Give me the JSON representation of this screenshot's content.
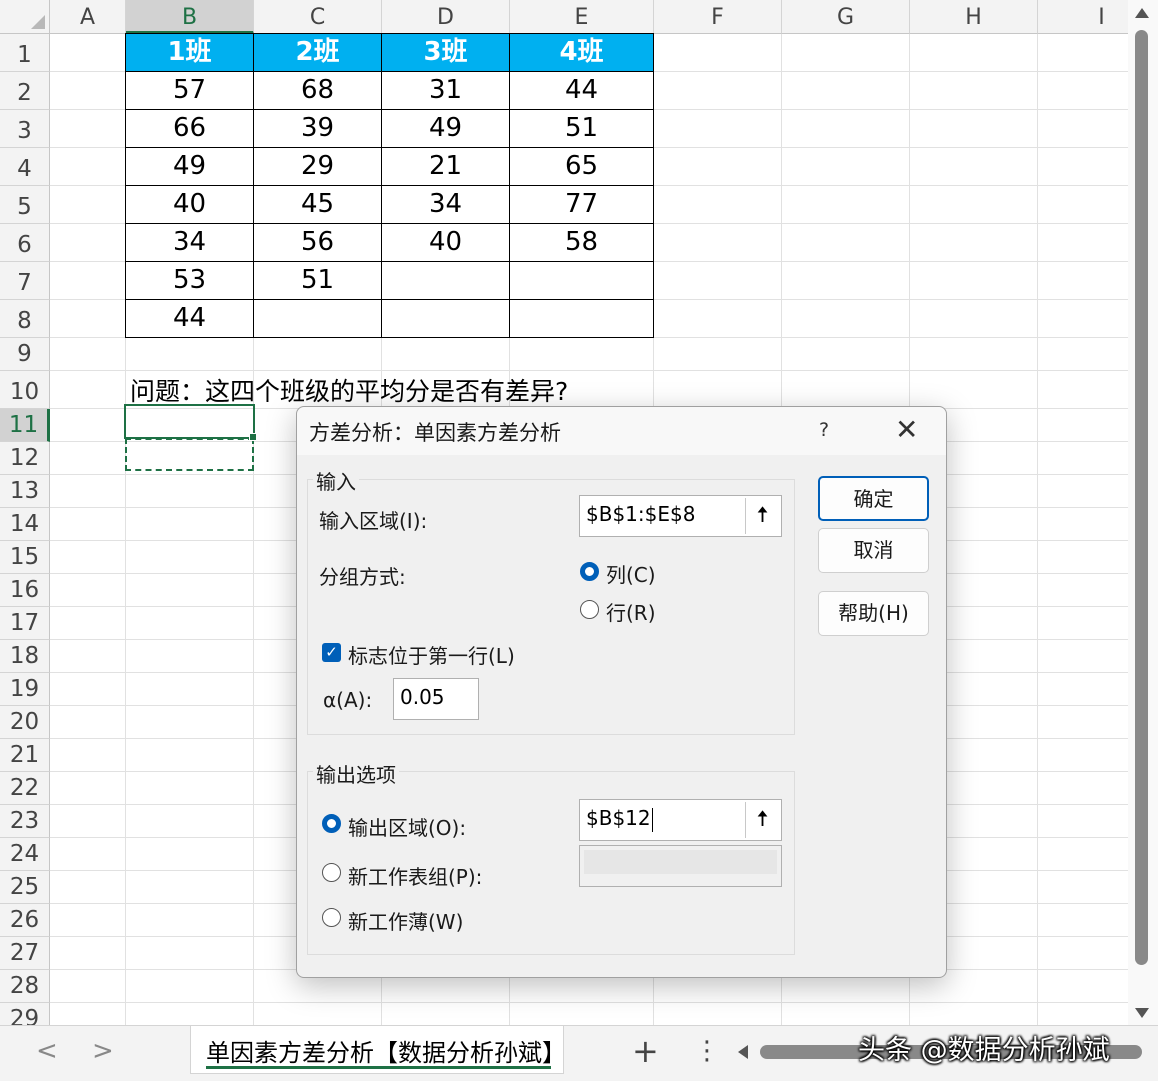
{
  "spreadsheet": {
    "columns": [
      "A",
      "B",
      "C",
      "D",
      "E",
      "F",
      "G",
      "H",
      "I"
    ],
    "rows": [
      "1",
      "2",
      "3",
      "4",
      "5",
      "6",
      "7",
      "8",
      "9",
      "10",
      "11",
      "12",
      "13",
      "14",
      "15",
      "16",
      "17",
      "18",
      "19",
      "20",
      "21",
      "22",
      "23",
      "24",
      "25",
      "26",
      "27",
      "28",
      "29"
    ],
    "selected_column": "B",
    "selected_row": "11",
    "table": {
      "headers": [
        "1班",
        "2班",
        "3班",
        "4班"
      ],
      "data": [
        [
          "57",
          "68",
          "31",
          "44"
        ],
        [
          "66",
          "39",
          "49",
          "51"
        ],
        [
          "49",
          "29",
          "21",
          "65"
        ],
        [
          "40",
          "45",
          "34",
          "77"
        ],
        [
          "34",
          "56",
          "40",
          "58"
        ],
        [
          "53",
          "51",
          "",
          ""
        ],
        [
          "44",
          "",
          "",
          ""
        ]
      ],
      "header_color": "#00b0f0"
    },
    "question": "问题：这四个班级的平均分是否有差异?"
  },
  "dialog": {
    "title": "方差分析：单因素方差分析",
    "help_symbol": "?",
    "close_symbol": "✕",
    "input_group": "输入",
    "input_range_label": "输入区域(I):",
    "input_range_value": "$B$1:$E$8",
    "grouping_label": "分组方式:",
    "grouping_column": "列(C)",
    "grouping_row": "行(R)",
    "grouping_selected": "列(C)",
    "labels_first_row": "标志位于第一行(L)",
    "labels_first_row_checked": true,
    "alpha_label": "α(A):",
    "alpha_value": "0.05",
    "output_group": "输出选项",
    "output_range_label": "输出区域(O):",
    "output_range_value": "$B$12",
    "new_worksheet_label": "新工作表组(P):",
    "new_workbook_label": "新工作薄(W)",
    "output_selected": "输出区域(O):",
    "ok_button": "确定",
    "cancel_button": "取消",
    "help_button": "帮助(H)",
    "accent_color": "#005fb8"
  },
  "bottom_bar": {
    "nav_prev": "<",
    "nav_next": ">",
    "sheet_tab": "单因素方差分析【数据分析孙斌】",
    "add_sheet": "+",
    "more": "⋮",
    "watermark": "头条 @数据分析孙斌"
  }
}
